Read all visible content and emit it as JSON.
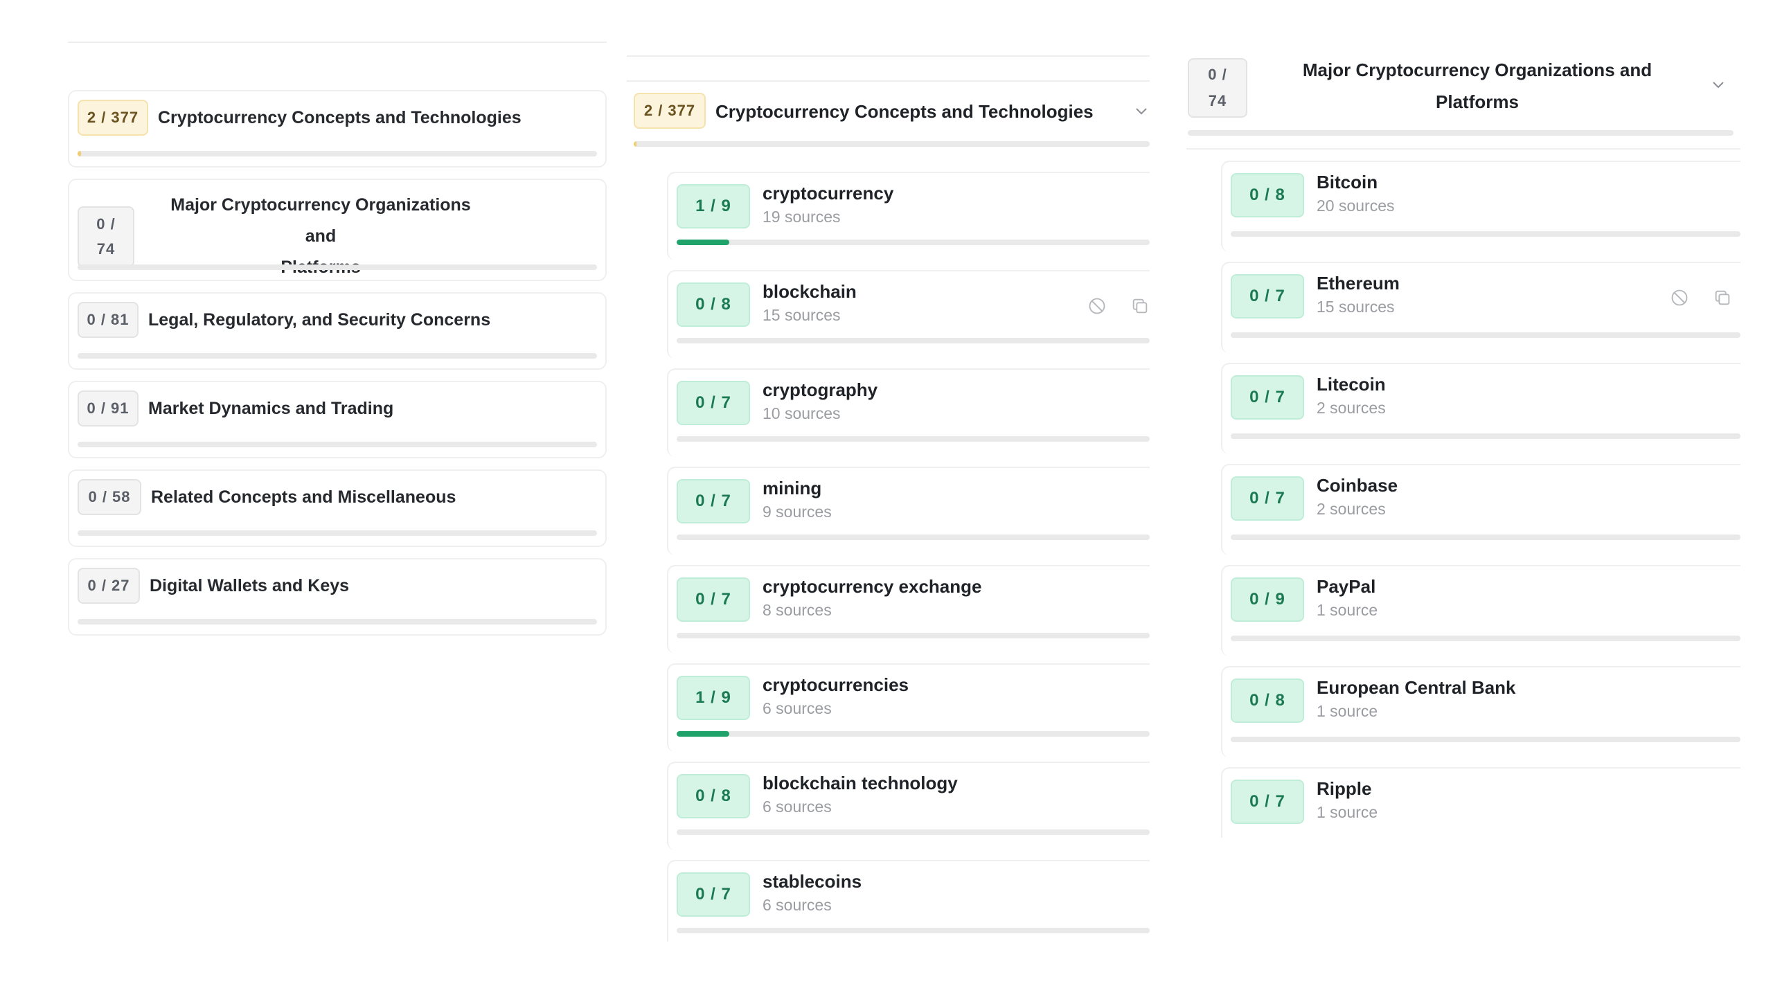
{
  "column1": {
    "categories": [
      {
        "badge": "2 / 377",
        "title": "Cryptocurrency Concepts and Technologies",
        "progress": 0.005,
        "style": "yellow"
      },
      {
        "badge_line1": "0 /",
        "badge_line2": "74",
        "title_line1": "Major Cryptocurrency Organizations and",
        "title_line2": "Platforms",
        "progress": 0,
        "style": "gray"
      },
      {
        "badge": "0 / 81",
        "title": "Legal, Regulatory, and Security Concerns",
        "progress": 0,
        "style": "gray"
      },
      {
        "badge": "0 / 91",
        "title": "Market Dynamics and Trading",
        "progress": 0,
        "style": "gray"
      },
      {
        "badge": "0 / 58",
        "title": "Related Concepts and Miscellaneous",
        "progress": 0,
        "style": "gray"
      },
      {
        "badge": "0 / 27",
        "title": "Digital Wallets and Keys",
        "progress": 0,
        "style": "gray"
      }
    ]
  },
  "column2": {
    "header": {
      "badge": "2 / 377",
      "title": "Cryptocurrency Concepts and Technologies",
      "progress": 0.005
    },
    "items": [
      {
        "badge": "1 / 9",
        "name": "cryptocurrency",
        "sources": "19 sources",
        "progress": 0.111
      },
      {
        "badge": "0 / 8",
        "name": "blockchain",
        "sources": "15 sources",
        "progress": 0,
        "hovered": true
      },
      {
        "badge": "0 / 7",
        "name": "cryptography",
        "sources": "10 sources",
        "progress": 0
      },
      {
        "badge": "0 / 7",
        "name": "mining",
        "sources": "9 sources",
        "progress": 0
      },
      {
        "badge": "0 / 7",
        "name": "cryptocurrency exchange",
        "sources": "8 sources",
        "progress": 0
      },
      {
        "badge": "1 / 9",
        "name": "cryptocurrencies",
        "sources": "6 sources",
        "progress": 0.111
      },
      {
        "badge": "0 / 8",
        "name": "blockchain technology",
        "sources": "6 sources",
        "progress": 0
      },
      {
        "badge": "0 / 7",
        "name": "stablecoins",
        "sources": "6 sources",
        "progress": 0
      }
    ]
  },
  "column3": {
    "header": {
      "badge_line1": "0 /",
      "badge_line2": "74",
      "title_line1": "Major Cryptocurrency Organizations and",
      "title_line2": "Platforms",
      "progress": 0
    },
    "items": [
      {
        "badge": "0 / 8",
        "name": "Bitcoin",
        "sources": "20 sources",
        "progress": 0
      },
      {
        "badge": "0 / 7",
        "name": "Ethereum",
        "sources": "15 sources",
        "progress": 0,
        "hovered": true
      },
      {
        "badge": "0 / 7",
        "name": "Litecoin",
        "sources": "2 sources",
        "progress": 0
      },
      {
        "badge": "0 / 7",
        "name": "Coinbase",
        "sources": "2 sources",
        "progress": 0
      },
      {
        "badge": "0 / 9",
        "name": "PayPal",
        "sources": "1 source",
        "progress": 0
      },
      {
        "badge": "0 / 8",
        "name": "European Central Bank",
        "sources": "1 source",
        "progress": 0
      },
      {
        "badge": "0 / 7",
        "name": "Ripple",
        "sources": "1 source",
        "progress": 0
      }
    ]
  },
  "icons": {
    "hide": "ban-icon",
    "copy": "copy-icon",
    "expand": "chevron-down-icon"
  },
  "colors": {
    "progress_green": "#1fa36b",
    "progress_yellow": "#f1cc72",
    "badge_green_bg": "#d6f5e6",
    "badge_yellow_bg": "#fdf4dd"
  }
}
